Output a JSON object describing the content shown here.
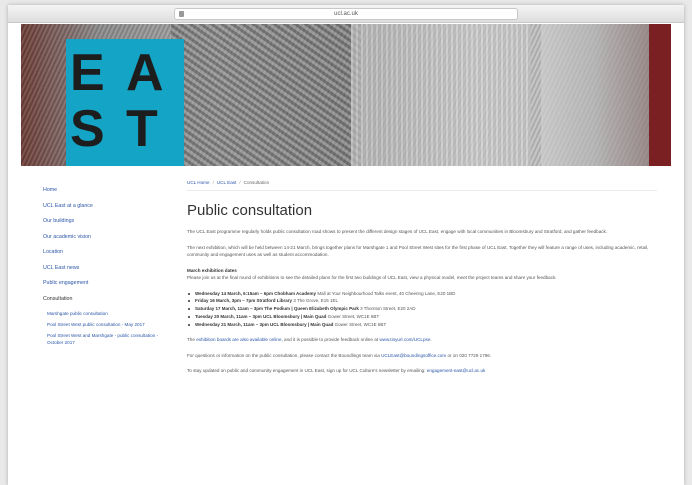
{
  "browser": {
    "url": "ucl.ac.uk"
  },
  "hero": {
    "logo_letters": [
      "E",
      "A",
      "S",
      "T"
    ]
  },
  "sidebar": {
    "items": [
      {
        "label": "Home"
      },
      {
        "label": "UCL East at a glance"
      },
      {
        "label": "Our buildings"
      },
      {
        "label": "Our academic vision"
      },
      {
        "label": "Location"
      },
      {
        "label": "UCL East news"
      },
      {
        "label": "Public engagement"
      },
      {
        "label": "Consultation"
      }
    ],
    "subitems": [
      {
        "label": "Marshgate public consultation"
      },
      {
        "label": "Pool Street West public consultation - May 2017"
      },
      {
        "label": "Pool Street West and Marshgate - public consultation - October 2017"
      }
    ]
  },
  "breadcrumb": {
    "home": "UCL Home",
    "section": "UCL East",
    "current": "Consultation"
  },
  "main": {
    "title": "Public consultation",
    "intro": "The UCL East programme regularly holds public consultation road shows to present the different design stages of UCL East, engage with local communities in Bloomsbury and Stratford, and gather feedback.",
    "next": "The next exhibition, which will be held between 14-21 March, brings together plans for Marshgate 1 and Pool Street West sites for the first phase of UCL East. Together they will feature a range of uses, including academic, retail, community and engagement uses as well as student accommodation.",
    "dates_heading": "March exhibition dates",
    "dates_intro": "Please join us at the final round of exhibitions to see the detailed plans for the first two buildings of UCL East, view a physical model, meet the project teams and share your feedback.",
    "dates": [
      {
        "when": "Wednesday 14 March, 6:15am – 6pm",
        "where": "Chobham Academy",
        "extra": "Mall at Your Neighbourhood Talks event, 40 Cheering Lane, E20 1BD"
      },
      {
        "when": "Friday 16 March, 3pm – 7pm",
        "where": "Stratford Library",
        "extra": "3 The Grove, E15 1EL"
      },
      {
        "when": "Saturday 17 March, 11am – 3pm",
        "where": "The Podium | Queen Elizabeth Olympic Park",
        "extra": "3 Thornton Street, E20 2AD"
      },
      {
        "when": "Tuesday 20 March, 11am – 3pm",
        "where": "UCL Bloomsbury | Main Quad",
        "extra": "Gower Street, WC1E 6BT"
      },
      {
        "when": "Wednesday 21 March, 11am – 3pm",
        "where": "UCL Bloomsbury | Main Quad",
        "extra": "Gower Street, WC1E 6BT"
      }
    ],
    "online_link": "exhibition boards are also available online",
    "online_rest": ", and it is possible to provide feedback online at ",
    "online_url": "www.tinyurl.com/UCLpse",
    "questions_pre": "For questions or information on the public consultation, please contact the Boundlings team via ",
    "questions_email": "UCLEast@boundingsoffice.com",
    "questions_post": " or on 020 7729 1796.",
    "newsletter_pre": "To stay updated on public and community engagement in UCL East, sign up for UCL Culture's newsletter by emailing: ",
    "newsletter_email": "engagement-east@ucl.ac.uk"
  }
}
